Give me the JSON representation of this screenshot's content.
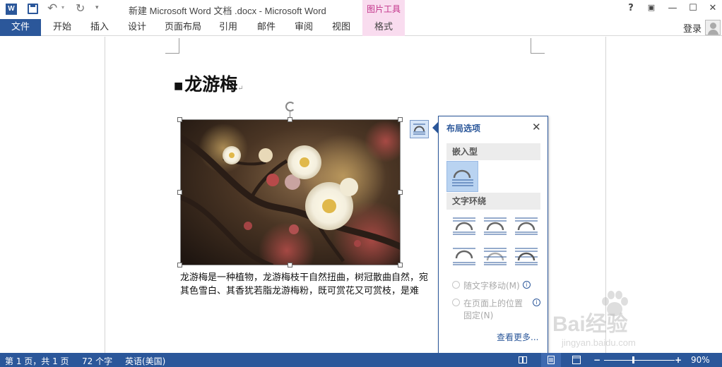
{
  "titlebar": {
    "app_logo": "W",
    "document_title": "新建 Microsoft Word 文档 .docx - Microsoft Word",
    "contextual_tools_label": "图片工具",
    "help": "?",
    "minimize": "—",
    "maximize": "☐",
    "close": "✕"
  },
  "ribbon": {
    "tabs": [
      "文件",
      "开始",
      "插入",
      "设计",
      "页面布局",
      "引用",
      "邮件",
      "审阅",
      "视图",
      "格式"
    ],
    "login": "登录"
  },
  "document": {
    "heading": "龙游梅",
    "body_line1": "龙游梅是一种植物，龙游梅枝干自然扭曲，树冠散曲自然，宛",
    "body_line2": "其色雪白、其香犹若脂龙游梅粉，既可赏花又可赏枝，是难"
  },
  "layout_panel": {
    "title": "布局选项",
    "section_inline": "嵌入型",
    "section_wrap": "文字环绕",
    "move_with_text": "随文字移动(M)",
    "fix_position_line1": "在页面上的位置",
    "fix_position_line2": "固定(N)",
    "see_more": "查看更多..."
  },
  "statusbar": {
    "page": "第 1 页，共 1 页",
    "word_count": "72 个字",
    "language": "英语(美国)",
    "zoom": "90%",
    "zoom_fraction": 0.45
  },
  "watermark": {
    "brand": "Bai经验",
    "url": "jingyan.baidu.com"
  },
  "colors": {
    "accent": "#2b579a",
    "contextual_tab": "#f9dcef"
  }
}
